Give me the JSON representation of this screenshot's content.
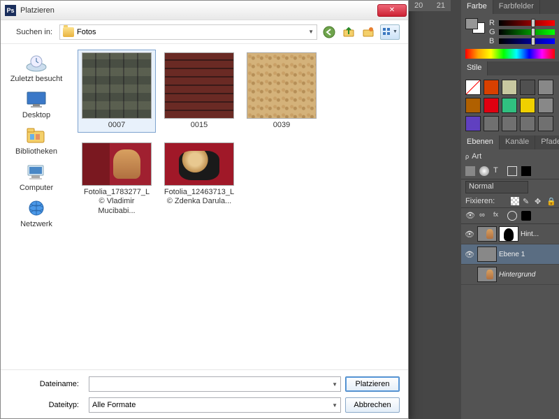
{
  "dialog": {
    "title": "Platzieren",
    "search_label": "Suchen in:",
    "folder_name": "Fotos",
    "nav": {
      "back": "←",
      "up": "↑"
    }
  },
  "sidebar": {
    "items": [
      {
        "label": "Zuletzt besucht",
        "icon": "recent"
      },
      {
        "label": "Desktop",
        "icon": "desktop"
      },
      {
        "label": "Bibliotheken",
        "icon": "libraries"
      },
      {
        "label": "Computer",
        "icon": "computer"
      },
      {
        "label": "Netzwerk",
        "icon": "network"
      }
    ]
  },
  "thumbs": [
    {
      "caption": "0007",
      "tex": "stone",
      "shape": "tall",
      "selected": true
    },
    {
      "caption": "0015",
      "tex": "brick",
      "shape": "tall",
      "selected": false
    },
    {
      "caption": "0039",
      "tex": "sand",
      "shape": "tall",
      "selected": false
    },
    {
      "caption": "Fotolia_1783277_L © Vladimir Mucibabi...",
      "tex": "fot1",
      "shape": "wide",
      "selected": false
    },
    {
      "caption": "Fotolia_12463713_L © Zdenka Darula...",
      "tex": "fot2",
      "shape": "wide",
      "selected": false
    }
  ],
  "bottom": {
    "filename_label": "Dateiname:",
    "filetype_label": "Dateityp:",
    "filetype_value": "Alle Formate",
    "filename_value": "",
    "primary": "Platzieren",
    "cancel": "Abbrechen"
  },
  "ruler": {
    "a": "20",
    "b": "21"
  },
  "panels": {
    "farbe": {
      "tabs": [
        "Farbe",
        "Farbfelder"
      ],
      "channels": [
        "R",
        "G",
        "B"
      ]
    },
    "stile": {
      "title": "Stile",
      "swatches": [
        "none",
        "#d84000",
        "#c8c8a0",
        "#505050",
        "#888",
        "#b06000",
        "#e00010",
        "#30c080",
        "#f0d000",
        "#888",
        "#6040c0",
        "#707070",
        "#707070",
        "#707070",
        "#707070"
      ]
    },
    "ebenen": {
      "tabs": [
        "Ebenen",
        "Kanäle",
        "Pfade"
      ],
      "type_label": "Art",
      "blend": "Normal",
      "fix_label": "Fixieren:",
      "layers": [
        {
          "name": "Hint...",
          "thumb": "fot1",
          "mask": true,
          "eye": true,
          "italic": false
        },
        {
          "name": "Ebene 1",
          "thumb": "gray",
          "mask": false,
          "eye": true,
          "selected": true,
          "italic": false
        },
        {
          "name": "Hintergrund",
          "thumb": "fot1",
          "mask": false,
          "eye": false,
          "italic": true
        }
      ]
    }
  }
}
